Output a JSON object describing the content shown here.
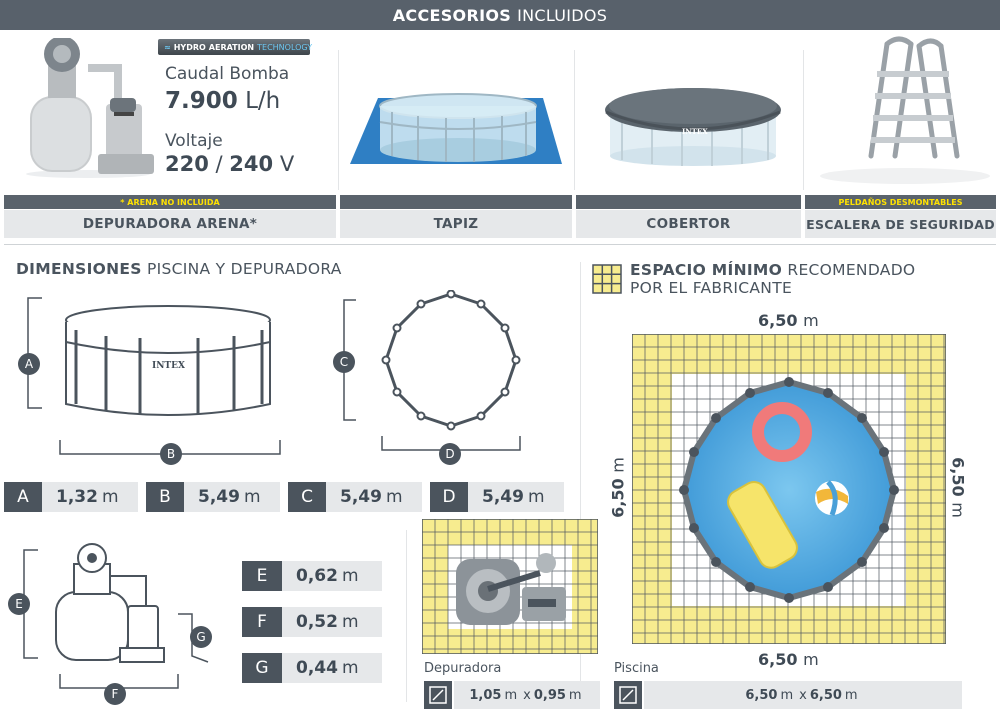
{
  "header": {
    "title_bold": "ACCESORIOS",
    "title_rest": "INCLUIDOS"
  },
  "pump": {
    "badge_a": "HYDRO",
    "badge_b": "AERATION",
    "badge_c": "TECHNOLOGY",
    "flow_label": "Caudal Bomba",
    "flow_value": "7.900",
    "flow_unit": "L/h",
    "volt_label": "Voltaje",
    "volt_a": "220",
    "volt_sep": "/",
    "volt_b": "240",
    "volt_unit": "V"
  },
  "notes": {
    "arena": "* ARENA NO INCLUIDA",
    "peldanos": "PELDAÑOS DESMONTABLES"
  },
  "accessories": [
    "DEPURADORA ARENA*",
    "TAPIZ",
    "COBERTOR",
    "ESCALERA DE SEGURIDAD"
  ],
  "cover_logo": "INTEX",
  "pool_logo": "INTEX",
  "dimensions": {
    "title_bold": "DIMENSIONES",
    "title_rest": "PISCINA Y DEPURADORA",
    "pool": [
      {
        "label": "A",
        "value": "1,32",
        "unit": "m"
      },
      {
        "label": "B",
        "value": "5,49",
        "unit": "m"
      },
      {
        "label": "C",
        "value": "5,49",
        "unit": "m"
      },
      {
        "label": "D",
        "value": "5,49",
        "unit": "m"
      }
    ],
    "pump": [
      {
        "label": "E",
        "value": "0,62",
        "unit": "m"
      },
      {
        "label": "F",
        "value": "0,52",
        "unit": "m"
      },
      {
        "label": "G",
        "value": "0,44",
        "unit": "m"
      }
    ]
  },
  "space": {
    "title_bold": "ESPACIO MÍNIMO",
    "title_rest": "RECOMENDADO",
    "title_line2": "POR EL FABRICANTE",
    "top_value": "6,50",
    "left_value": "6,50",
    "right_value": "6,50",
    "bottom_value": "6,50",
    "unit": "m",
    "depuradora_label": "Depuradora",
    "depuradora_size_a": "1,05",
    "depuradora_size_b": "0,95",
    "times": "x",
    "piscina_label": "Piscina",
    "piscina_size_a": "6,50",
    "piscina_size_b": "6,50"
  },
  "colors": {
    "dark": "#4b545d",
    "light": "#e6e8ea",
    "yellow": "#f7ec8f",
    "accent_yellow": "#ffe200",
    "water": "#4aa6e0"
  }
}
